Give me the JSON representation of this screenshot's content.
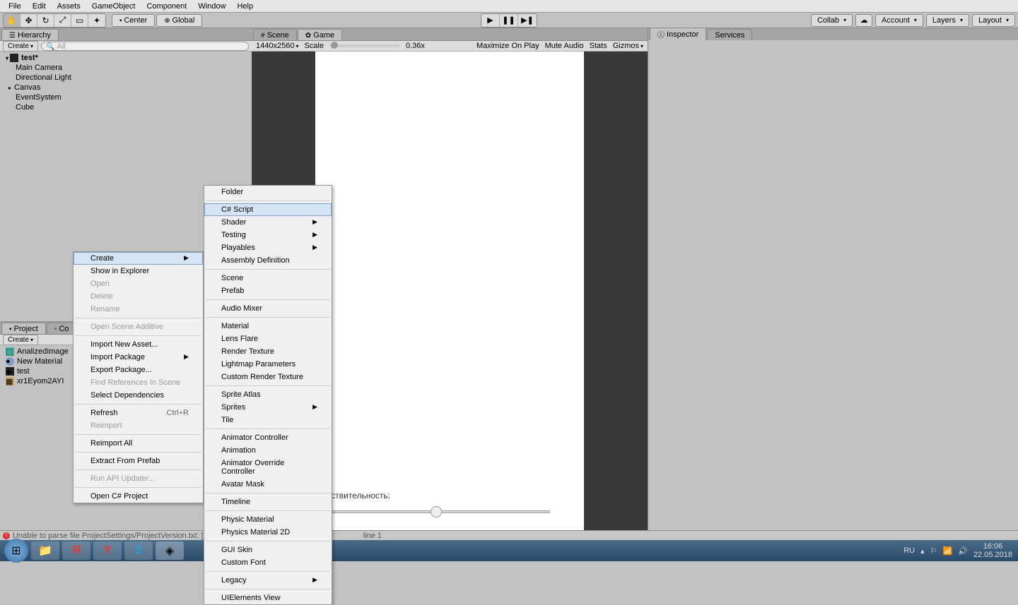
{
  "menubar": [
    "File",
    "Edit",
    "Assets",
    "GameObject",
    "Component",
    "Window",
    "Help"
  ],
  "toolbar": {
    "pivot_center": "Center",
    "pivot_global": "Global",
    "collab": "Collab",
    "account": "Account",
    "layers": "Layers",
    "layout": "Layout"
  },
  "hierarchy": {
    "tab": "Hierarchy",
    "create": "Create",
    "search_placeholder": "All",
    "scene": "test*",
    "items": [
      "Main Camera",
      "Directional Light",
      "Canvas",
      "EventSystem",
      "Cube"
    ]
  },
  "project": {
    "tab": "Project",
    "tab2": "Co",
    "create": "Create",
    "items": [
      "AnalizedImage",
      "New Material",
      "test",
      "xr1Eyom2AYI"
    ]
  },
  "scene_tab": "Scene",
  "game": {
    "tab": "Game",
    "resolution": "1440x2560",
    "scale_label": "Scale",
    "scale_value": "0.36x",
    "maximize": "Maximize On Play",
    "mute": "Mute Audio",
    "stats": "Stats",
    "gizmos": "Gizmos",
    "sensitivity_label": "Чувствительность:"
  },
  "inspector": {
    "tab": "Inspector",
    "tab2": "Services"
  },
  "context1": {
    "items": [
      {
        "label": "Create",
        "highlighted": true,
        "arrow": true
      },
      {
        "label": "Show in Explorer"
      },
      {
        "label": "Open",
        "disabled": true
      },
      {
        "label": "Delete",
        "disabled": true
      },
      {
        "label": "Rename",
        "disabled": true
      },
      {
        "sep": true
      },
      {
        "label": "Open Scene Additive",
        "disabled": true
      },
      {
        "sep": true
      },
      {
        "label": "Import New Asset..."
      },
      {
        "label": "Import Package",
        "arrow": true
      },
      {
        "label": "Export Package..."
      },
      {
        "label": "Find References In Scene",
        "disabled": true
      },
      {
        "label": "Select Dependencies"
      },
      {
        "sep": true
      },
      {
        "label": "Refresh",
        "shortcut": "Ctrl+R"
      },
      {
        "label": "Reimport",
        "disabled": true
      },
      {
        "sep": true
      },
      {
        "label": "Reimport All"
      },
      {
        "sep": true
      },
      {
        "label": "Extract From Prefab"
      },
      {
        "sep": true
      },
      {
        "label": "Run API Updater...",
        "disabled": true
      },
      {
        "sep": true
      },
      {
        "label": "Open C# Project"
      }
    ]
  },
  "context2": {
    "items": [
      {
        "label": "Folder"
      },
      {
        "sep": true
      },
      {
        "label": "C# Script",
        "highlighted": true
      },
      {
        "label": "Shader",
        "arrow": true
      },
      {
        "label": "Testing",
        "arrow": true
      },
      {
        "label": "Playables",
        "arrow": true
      },
      {
        "label": "Assembly Definition"
      },
      {
        "sep": true
      },
      {
        "label": "Scene"
      },
      {
        "label": "Prefab"
      },
      {
        "sep": true
      },
      {
        "label": "Audio Mixer"
      },
      {
        "sep": true
      },
      {
        "label": "Material"
      },
      {
        "label": "Lens Flare"
      },
      {
        "label": "Render Texture"
      },
      {
        "label": "Lightmap Parameters"
      },
      {
        "label": "Custom Render Texture"
      },
      {
        "sep": true
      },
      {
        "label": "Sprite Atlas"
      },
      {
        "label": "Sprites",
        "arrow": true
      },
      {
        "label": "Tile"
      },
      {
        "sep": true
      },
      {
        "label": "Animator Controller"
      },
      {
        "label": "Animation"
      },
      {
        "label": "Animator Override Controller"
      },
      {
        "label": "Avatar Mask"
      },
      {
        "sep": true
      },
      {
        "label": "Timeline"
      },
      {
        "sep": true
      },
      {
        "label": "Physic Material"
      },
      {
        "label": "Physics Material 2D"
      },
      {
        "sep": true
      },
      {
        "label": "GUI Skin"
      },
      {
        "label": "Custom Font"
      },
      {
        "sep": true
      },
      {
        "label": "Legacy",
        "arrow": true
      },
      {
        "sep": true
      },
      {
        "label": "UIElements View"
      }
    ]
  },
  "status": {
    "error": "Unable to parse file ProjectSettings/ProjectVersion.txt: [mappin",
    "line": "line 1"
  },
  "taskbar": {
    "lang": "RU",
    "time": "16:06",
    "date": "22.05.2018"
  }
}
